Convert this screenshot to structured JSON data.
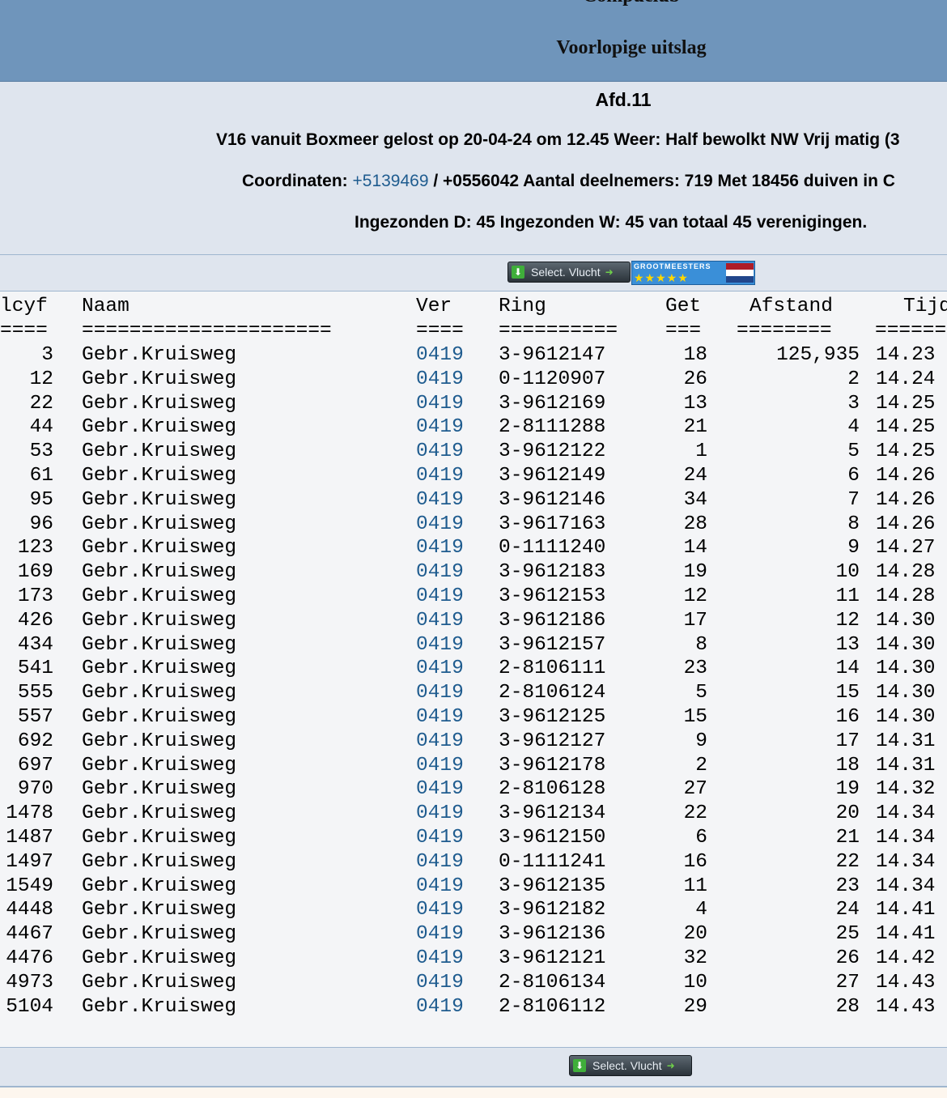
{
  "header": {
    "club": "Compuclub",
    "subtitle": "Voorlopige uitslag"
  },
  "info": {
    "afd": "Afd.11",
    "line1": "V16 vanuit Boxmeer gelost op 20-04-24 om 12.45 Weer: Half bewolkt NW Vrij matig (3",
    "coord_label": "Coordinaten: ",
    "coord_link": "+5139469",
    "coord_rest": " / +0556042 Aantal deelnemers: 719 Met 18456 duiven in C",
    "line3": "Ingezonden D: 45 Ingezonden W: 45 van totaal 45 verenigingen."
  },
  "toolbar": {
    "select_label": "Select. Vlucht",
    "grootmeesters_text": "GROOTMEESTERS",
    "grootmeesters_stars": "★★★★★",
    "flag_colors": [
      "#ae1c28",
      "#ffffff",
      "#21468b"
    ]
  },
  "table": {
    "headers": {
      "pl": "lcyf",
      "naam": "Naam",
      "ver": "Ver",
      "ring": "Ring",
      "get": "Get",
      "afstand": "Afstand",
      "tijd": "Tijd"
    },
    "separators": {
      "pl": "====",
      "naam": "=====================",
      "ver": "====",
      "ring": "==========",
      "get": "===",
      "afstand": "========",
      "tijd": "======"
    },
    "rows": [
      {
        "pl": "3",
        "naam": "Gebr.Kruisweg",
        "ver": "0419",
        "ring": "3-9612147",
        "get": "18",
        "afstand": "125,935",
        "tijd": "14.23"
      },
      {
        "pl": "12",
        "naam": "Gebr.Kruisweg",
        "ver": "0419",
        "ring": "0-1120907",
        "get": "26",
        "afstand": "2",
        "tijd": "14.24"
      },
      {
        "pl": "22",
        "naam": "Gebr.Kruisweg",
        "ver": "0419",
        "ring": "3-9612169",
        "get": "13",
        "afstand": "3",
        "tijd": "14.25"
      },
      {
        "pl": "44",
        "naam": "Gebr.Kruisweg",
        "ver": "0419",
        "ring": "2-8111288",
        "get": "21",
        "afstand": "4",
        "tijd": "14.25"
      },
      {
        "pl": "53",
        "naam": "Gebr.Kruisweg",
        "ver": "0419",
        "ring": "3-9612122",
        "get": "1",
        "afstand": "5",
        "tijd": "14.25"
      },
      {
        "pl": "61",
        "naam": "Gebr.Kruisweg",
        "ver": "0419",
        "ring": "3-9612149",
        "get": "24",
        "afstand": "6",
        "tijd": "14.26"
      },
      {
        "pl": "95",
        "naam": "Gebr.Kruisweg",
        "ver": "0419",
        "ring": "3-9612146",
        "get": "34",
        "afstand": "7",
        "tijd": "14.26"
      },
      {
        "pl": "96",
        "naam": "Gebr.Kruisweg",
        "ver": "0419",
        "ring": "3-9617163",
        "get": "28",
        "afstand": "8",
        "tijd": "14.26"
      },
      {
        "pl": "123",
        "naam": "Gebr.Kruisweg",
        "ver": "0419",
        "ring": "0-1111240",
        "get": "14",
        "afstand": "9",
        "tijd": "14.27"
      },
      {
        "pl": "169",
        "naam": "Gebr.Kruisweg",
        "ver": "0419",
        "ring": "3-9612183",
        "get": "19",
        "afstand": "10",
        "tijd": "14.28"
      },
      {
        "pl": "173",
        "naam": "Gebr.Kruisweg",
        "ver": "0419",
        "ring": "3-9612153",
        "get": "12",
        "afstand": "11",
        "tijd": "14.28"
      },
      {
        "pl": "426",
        "naam": "Gebr.Kruisweg",
        "ver": "0419",
        "ring": "3-9612186",
        "get": "17",
        "afstand": "12",
        "tijd": "14.30"
      },
      {
        "pl": "434",
        "naam": "Gebr.Kruisweg",
        "ver": "0419",
        "ring": "3-9612157",
        "get": "8",
        "afstand": "13",
        "tijd": "14.30"
      },
      {
        "pl": "541",
        "naam": "Gebr.Kruisweg",
        "ver": "0419",
        "ring": "2-8106111",
        "get": "23",
        "afstand": "14",
        "tijd": "14.30"
      },
      {
        "pl": "555",
        "naam": "Gebr.Kruisweg",
        "ver": "0419",
        "ring": "2-8106124",
        "get": "5",
        "afstand": "15",
        "tijd": "14.30"
      },
      {
        "pl": "557",
        "naam": "Gebr.Kruisweg",
        "ver": "0419",
        "ring": "3-9612125",
        "get": "15",
        "afstand": "16",
        "tijd": "14.30"
      },
      {
        "pl": "692",
        "naam": "Gebr.Kruisweg",
        "ver": "0419",
        "ring": "3-9612127",
        "get": "9",
        "afstand": "17",
        "tijd": "14.31"
      },
      {
        "pl": "697",
        "naam": "Gebr.Kruisweg",
        "ver": "0419",
        "ring": "3-9612178",
        "get": "2",
        "afstand": "18",
        "tijd": "14.31"
      },
      {
        "pl": "970",
        "naam": "Gebr.Kruisweg",
        "ver": "0419",
        "ring": "2-8106128",
        "get": "27",
        "afstand": "19",
        "tijd": "14.32"
      },
      {
        "pl": "1478",
        "naam": "Gebr.Kruisweg",
        "ver": "0419",
        "ring": "3-9612134",
        "get": "22",
        "afstand": "20",
        "tijd": "14.34"
      },
      {
        "pl": "1487",
        "naam": "Gebr.Kruisweg",
        "ver": "0419",
        "ring": "3-9612150",
        "get": "6",
        "afstand": "21",
        "tijd": "14.34"
      },
      {
        "pl": "1497",
        "naam": "Gebr.Kruisweg",
        "ver": "0419",
        "ring": "0-1111241",
        "get": "16",
        "afstand": "22",
        "tijd": "14.34"
      },
      {
        "pl": "1549",
        "naam": "Gebr.Kruisweg",
        "ver": "0419",
        "ring": "3-9612135",
        "get": "11",
        "afstand": "23",
        "tijd": "14.34"
      },
      {
        "pl": "4448",
        "naam": "Gebr.Kruisweg",
        "ver": "0419",
        "ring": "3-9612182",
        "get": "4",
        "afstand": "24",
        "tijd": "14.41"
      },
      {
        "pl": "4467",
        "naam": "Gebr.Kruisweg",
        "ver": "0419",
        "ring": "3-9612136",
        "get": "20",
        "afstand": "25",
        "tijd": "14.41"
      },
      {
        "pl": "4476",
        "naam": "Gebr.Kruisweg",
        "ver": "0419",
        "ring": "3-9612121",
        "get": "32",
        "afstand": "26",
        "tijd": "14.42"
      },
      {
        "pl": "4973",
        "naam": "Gebr.Kruisweg",
        "ver": "0419",
        "ring": "2-8106134",
        "get": "10",
        "afstand": "27",
        "tijd": "14.43"
      },
      {
        "pl": "5104",
        "naam": "Gebr.Kruisweg",
        "ver": "0419",
        "ring": "2-8106112",
        "get": "29",
        "afstand": "28",
        "tijd": "14.43"
      }
    ]
  }
}
